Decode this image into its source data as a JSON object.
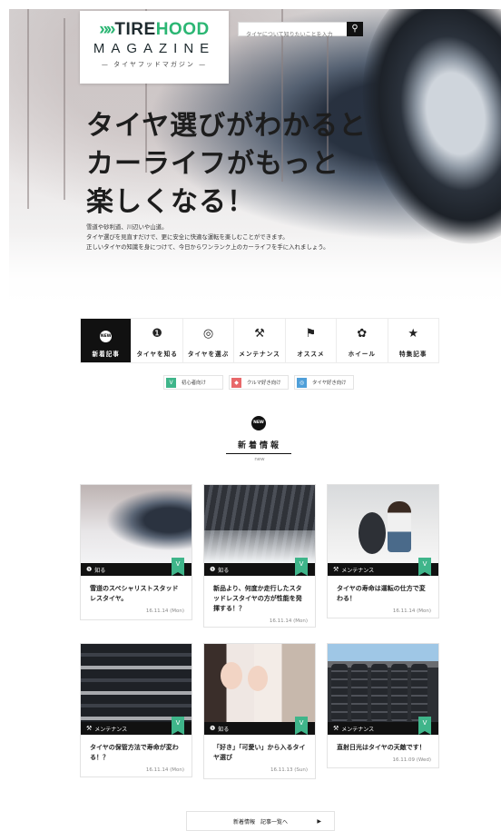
{
  "logo": {
    "chevrons": "»»",
    "tire": "TIRE",
    "hood": "HOOD",
    "magazine": "MAGAZINE",
    "sub": "— タイヤフッドマガジン —"
  },
  "search": {
    "placeholder": "タイヤについて知りたいことを入力",
    "button_icon": "search-icon"
  },
  "hero": {
    "title_lines": [
      "タイヤ選びがわかると",
      "カーライフがもっと",
      "楽しくなる！"
    ],
    "desc_lines": [
      "雪道や砂利道、川辺いや山道。",
      "タイヤ選びを見直すだけで、更に安全に快適な運転を楽しむことができます。",
      "正しいタイヤの知識を身につけて、今日からワンランク上のカーライフを手に入れましょう。"
    ]
  },
  "categories": [
    {
      "label": "新着記事",
      "icon": "new-badge-icon",
      "glyph": "NEW",
      "active": true
    },
    {
      "label": "タイヤを知る",
      "icon": "info-icon",
      "glyph": "❶",
      "active": false
    },
    {
      "label": "タイヤを選ぶ",
      "icon": "tire-icon",
      "glyph": "◎",
      "active": false
    },
    {
      "label": "メンテナンス",
      "icon": "tools-icon",
      "glyph": "⚒",
      "active": false
    },
    {
      "label": "オススメ",
      "icon": "checkered-flag-icon",
      "glyph": "⚑",
      "active": false
    },
    {
      "label": "ホイール",
      "icon": "wheel-icon",
      "glyph": "✿",
      "active": false
    },
    {
      "label": "特集記事",
      "icon": "star-icon",
      "glyph": "★",
      "active": false
    }
  ],
  "levels": [
    {
      "label": "初心者向け",
      "icon": "beginner-mark-icon",
      "color": "#3fb58a",
      "glyph": "V"
    },
    {
      "label": "クルマ好き向け",
      "icon": "car-icon",
      "color": "#e8686a",
      "glyph": "◆"
    },
    {
      "label": "タイヤ好き向け",
      "icon": "tire-icon",
      "color": "#4f9fd9",
      "glyph": "◎"
    }
  ],
  "section": {
    "badge": "NEW",
    "title": "新着情報",
    "sub": "new"
  },
  "cards": [
    {
      "category": "知る",
      "cat_glyph": "❶",
      "title": "雪道のスペシャリストスタッドレスタイヤ。",
      "date": "16.11.14 (Mon)"
    },
    {
      "category": "知る",
      "cat_glyph": "❶",
      "title": "新品より、何度か走行したスタッドレスタイヤの方が性能を発揮する！？",
      "date": "16.11.14 (Mon)"
    },
    {
      "category": "メンテナンス",
      "cat_glyph": "⚒",
      "title": "タイヤの寿命は運転の仕方で変わる！",
      "date": "16.11.14 (Mon)"
    },
    {
      "category": "メンテナンス",
      "cat_glyph": "⚒",
      "title": "タイヤの保管方法で寿命が変わる！？",
      "date": "16.11.14 (Mon)"
    },
    {
      "category": "知る",
      "cat_glyph": "❶",
      "title": "「好き」「可愛い」から入るタイヤ選び",
      "date": "16.11.13 (Sun)"
    },
    {
      "category": "メンテナンス",
      "cat_glyph": "⚒",
      "title": "直射日光はタイヤの天敵です！",
      "date": "16.11.09 (Wed)"
    }
  ],
  "more": {
    "label": "新着情報　記事一覧へ",
    "arrow": "▶"
  }
}
